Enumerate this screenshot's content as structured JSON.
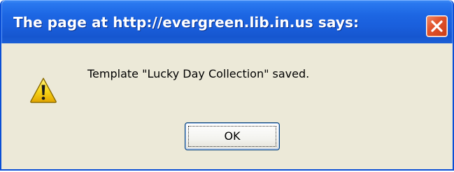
{
  "dialog": {
    "title": "The page at http://evergreen.lib.in.us says:",
    "message": "Template \"Lucky Day Collection\" saved.",
    "ok_label": "OK",
    "icon": "warning-icon",
    "close_icon": "close-icon"
  },
  "colors": {
    "titlebar": "#1c66e3",
    "body": "#ece9d8",
    "close_button": "#e2542d",
    "warning_yellow": "#f7d417"
  }
}
